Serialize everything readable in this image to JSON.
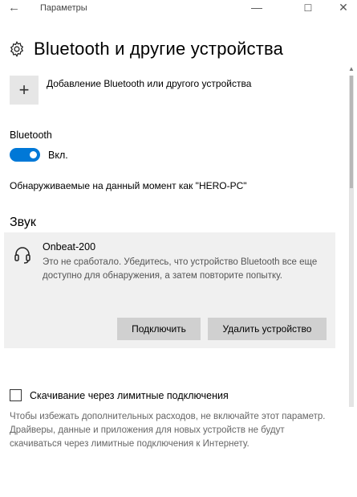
{
  "window": {
    "title": "Параметры",
    "back_glyph": "←",
    "minimize_glyph": "—",
    "maximize_glyph": "☐",
    "close_glyph": "✕"
  },
  "page": {
    "title": "Bluetooth и другие устройства",
    "icon": "gear-icon"
  },
  "add_device": {
    "plus": "+",
    "label": "Добавление Bluetooth или другого устройства"
  },
  "bluetooth": {
    "label": "Bluetooth",
    "toggle_state": "Вкл.",
    "toggle_on": true,
    "accent_color": "#0078d7",
    "discoverable_text": "Обнаруживаемые на данный момент как \"HERO-PC\""
  },
  "sound_section": {
    "heading": "Звук",
    "device": {
      "icon": "headset-icon",
      "name": "Onbeat-200",
      "message": "Это не сработало. Убедитесь, что устройство Bluetooth все еще доступно для обнаружения, а затем повторите попытку.",
      "connect_label": "Подключить",
      "remove_label": "Удалить устройство"
    }
  },
  "metered": {
    "checkbox_label": "Скачивание через лимитные подключения",
    "checked": false,
    "description": "Чтобы избежать дополнительных расходов, не включайте этот параметр. Драйверы, данные и приложения для новых устройств не будут скачиваться через лимитные подключения к Интернету."
  }
}
